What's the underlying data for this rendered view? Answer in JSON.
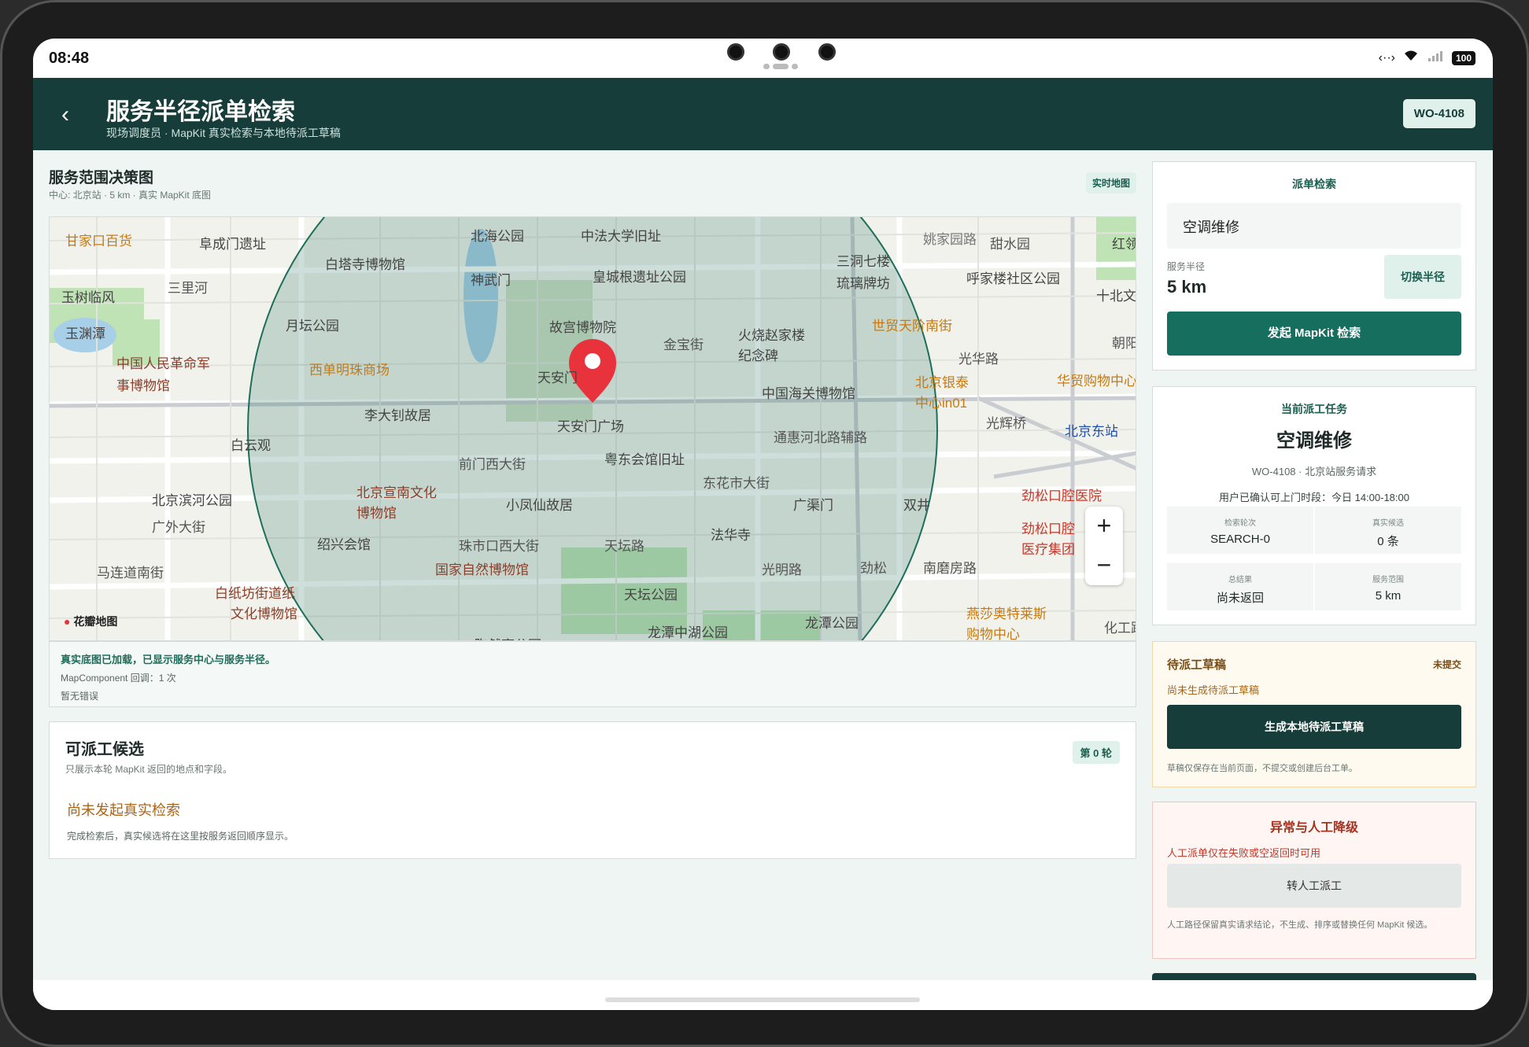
{
  "status_bar": {
    "time": "08:48",
    "battery": "100"
  },
  "header": {
    "title": "服务半径派单检索",
    "subtitle": "现场调度员 · MapKit 真实检索与本地待派工草稿",
    "work_order": "WO-4108"
  },
  "map_section": {
    "title": "服务范围决策图",
    "meta": "中心: 北京站 · 5 km · 真实 MapKit 底图",
    "tag": "实时地图",
    "zoom_in": "+",
    "zoom_out": "−",
    "logo": "花瓣地图",
    "labels": [
      "甘家口百货",
      "阜成门遗址",
      "白塔寺博物馆",
      "北海公园",
      "中法大学旧址",
      "三洞七楼",
      "琉璃牌坊",
      "姚家园路",
      "甜水园",
      "红领",
      "三里河",
      "神武门",
      "皇城根遗址公园",
      "呼家楼社区公园",
      "十北文化",
      "玉树临风",
      "月坛公园",
      "故宫博物院",
      "世贸天阶南街",
      "玉渊潭",
      "金宝街",
      "火烧赵家楼",
      "纪念碑",
      "朝阳",
      "中国人民革命军",
      "事博物馆",
      "西单明珠商场",
      "天安门",
      "光华路",
      "中国海关博物馆",
      "北京银泰",
      "中心in01",
      "华贸购物中心",
      "李大钊故居",
      "天安门广场",
      "光辉桥",
      "通惠河北路辅路",
      "北京东站",
      "白云观",
      "前门西大街",
      "粤东会馆旧址",
      "东花市大街",
      "北京宣南文化",
      "博物馆",
      "北京滨河公园",
      "小凤仙故居",
      "广渠门",
      "双井",
      "劲松口腔医院",
      "广外大街",
      "珠市口西大街",
      "法华寺",
      "劲松口腔",
      "医疗集团",
      "绍兴会馆",
      "天坛路",
      "马连道南街",
      "国家自然博物馆",
      "光明路",
      "劲松",
      "南磨房路",
      "白纸坊街道纸",
      "文化博物馆",
      "天坛公园",
      "燕莎奥特莱斯",
      "购物中心",
      "龙潭中湖公园",
      "龙潭公园",
      "化工路",
      "陶然亭公园"
    ]
  },
  "map_info": {
    "line1": "真实底图已加载，已显示服务中心与服务半径。",
    "line2": "MapComponent 回调：1 次",
    "line3": "暂无错误"
  },
  "candidates": {
    "title": "可派工候选",
    "subtitle": "只展示本轮 MapKit 返回的地点和字段。",
    "round": "第 0 轮",
    "empty_title": "尚未发起真实检索",
    "empty_desc": "完成检索后，真实候选将在这里按服务返回顺序显示。"
  },
  "search_panel": {
    "title": "派单检索",
    "query": "空调维修",
    "radius_label": "服务半径",
    "radius_value": "5 km",
    "switch_label": "切换半径",
    "search_button": "发起 MapKit 检索"
  },
  "task_panel": {
    "title": "当前派工任务",
    "task_name": "空调维修",
    "meta": "WO-4108 · 北京站服务请求",
    "time_window": "用户已确认可上门时段：今日 14:00-18:00",
    "stats": [
      {
        "key": "检索轮次",
        "value": "SEARCH-0"
      },
      {
        "key": "真实候选",
        "value": "0 条"
      },
      {
        "key": "总结果",
        "value": "尚未返回"
      },
      {
        "key": "服务范围",
        "value": "5 km"
      }
    ]
  },
  "draft_panel": {
    "title": "待派工草稿",
    "status": "未提交",
    "subtitle": "尚未生成待派工草稿",
    "button": "生成本地待派工草稿",
    "note": "草稿仅保存在当前页面，不提交或创建后台工单。"
  },
  "manual_panel": {
    "title": "异常与人工降级",
    "subtitle": "人工派单仅在失败或空返回时可用",
    "button": "转人工派工",
    "note": "人工路径保留真实请求结论，不生成、排序或替换任何 MapKit 候选。"
  },
  "colors": {
    "header_bg": "#163d39",
    "primary": "#166e5e",
    "accent_soft": "#dff1ea",
    "draft_bg": "#fffaf0",
    "manual_bg": "#fff6f4",
    "pin": "#e8333d"
  }
}
